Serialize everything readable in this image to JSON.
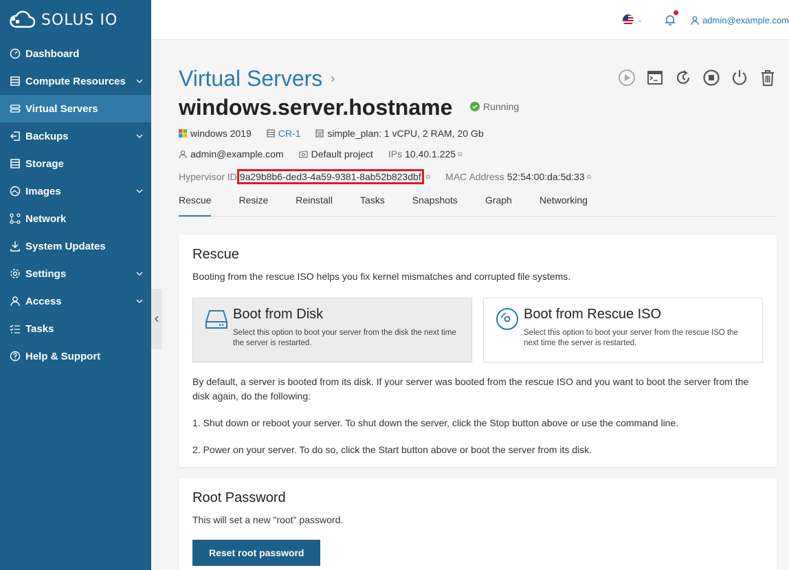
{
  "app": {
    "logo_text": "SOLUS IO"
  },
  "sidebar": {
    "items": [
      {
        "label": "Dashboard",
        "icon": "dashboard-icon",
        "has_chevron": false
      },
      {
        "label": "Compute Resources",
        "icon": "compute-icon",
        "has_chevron": true
      },
      {
        "label": "Virtual Servers",
        "icon": "servers-icon",
        "has_chevron": false,
        "active": true
      },
      {
        "label": "Backups",
        "icon": "backups-icon",
        "has_chevron": true
      },
      {
        "label": "Storage",
        "icon": "storage-icon",
        "has_chevron": false
      },
      {
        "label": "Images",
        "icon": "images-icon",
        "has_chevron": true
      },
      {
        "label": "Network",
        "icon": "network-icon",
        "has_chevron": false
      },
      {
        "label": "System Updates",
        "icon": "updates-icon",
        "has_chevron": false
      },
      {
        "label": "Settings",
        "icon": "gear-icon",
        "has_chevron": true
      },
      {
        "label": "Access",
        "icon": "user-icon",
        "has_chevron": true
      },
      {
        "label": "Tasks",
        "icon": "tasks-icon",
        "has_chevron": false
      },
      {
        "label": "Help & Support",
        "icon": "help-icon",
        "has_chevron": false
      }
    ]
  },
  "topbar": {
    "user": "admin@example.com",
    "language_icon": "us-flag-icon",
    "notifications_icon": "bell-icon"
  },
  "header": {
    "breadcrumb": "Virtual Servers",
    "breadcrumb_sep": "›",
    "hostname": "windows.server.hostname",
    "status": "Running"
  },
  "meta": {
    "os": "windows 2019",
    "compute_resource": "CR-1",
    "plan": "simple_plan: 1 vCPU, 2 RAM, 20 Gb",
    "owner": "admin@example.com",
    "project": "Default project",
    "ips_label": "IPs",
    "ips": "10.40.1.225",
    "hypervisor_label": "Hypervisor ID",
    "hypervisor_id": "9a29b8b6-ded3-4a59-9381-8ab52b823dbf",
    "mac_label": "MAC Address",
    "mac": "52:54:00:da:5d:33"
  },
  "tabs": [
    "Rescue",
    "Resize",
    "Reinstall",
    "Tasks",
    "Snapshots",
    "Graph",
    "Networking"
  ],
  "rescue": {
    "title": "Rescue",
    "intro": "Booting from the rescue ISO helps you fix kernel mismatches and corrupted file systems.",
    "option_disk_title": "Boot from Disk",
    "option_disk_desc": "Select this option to boot your server from the disk the next time the server is restarted.",
    "option_iso_title": "Boot from Rescue ISO",
    "option_iso_desc": "Select this option to boot your server from the rescue ISO the next time the server is restarted.",
    "para1": "By default, a server is booted from its disk. If your server was booted from the rescue ISO and you want to boot the server from the disk again, do the following:",
    "step1": "1. Shut down or reboot your server. To shut down the server, click the Stop button above or use the command line.",
    "step2": "2. Power on your server. To do so, click the Start button above or boot the server from its disk."
  },
  "root_password": {
    "title": "Root Password",
    "desc": "This will set a new \"root\" password.",
    "button": "Reset root password"
  },
  "colors": {
    "sidebar": "#1c5f88",
    "accent": "#2a7ab0",
    "active_nav": "#2f7aa6",
    "highlight": "#e01a22",
    "running": "#5fa84a"
  }
}
